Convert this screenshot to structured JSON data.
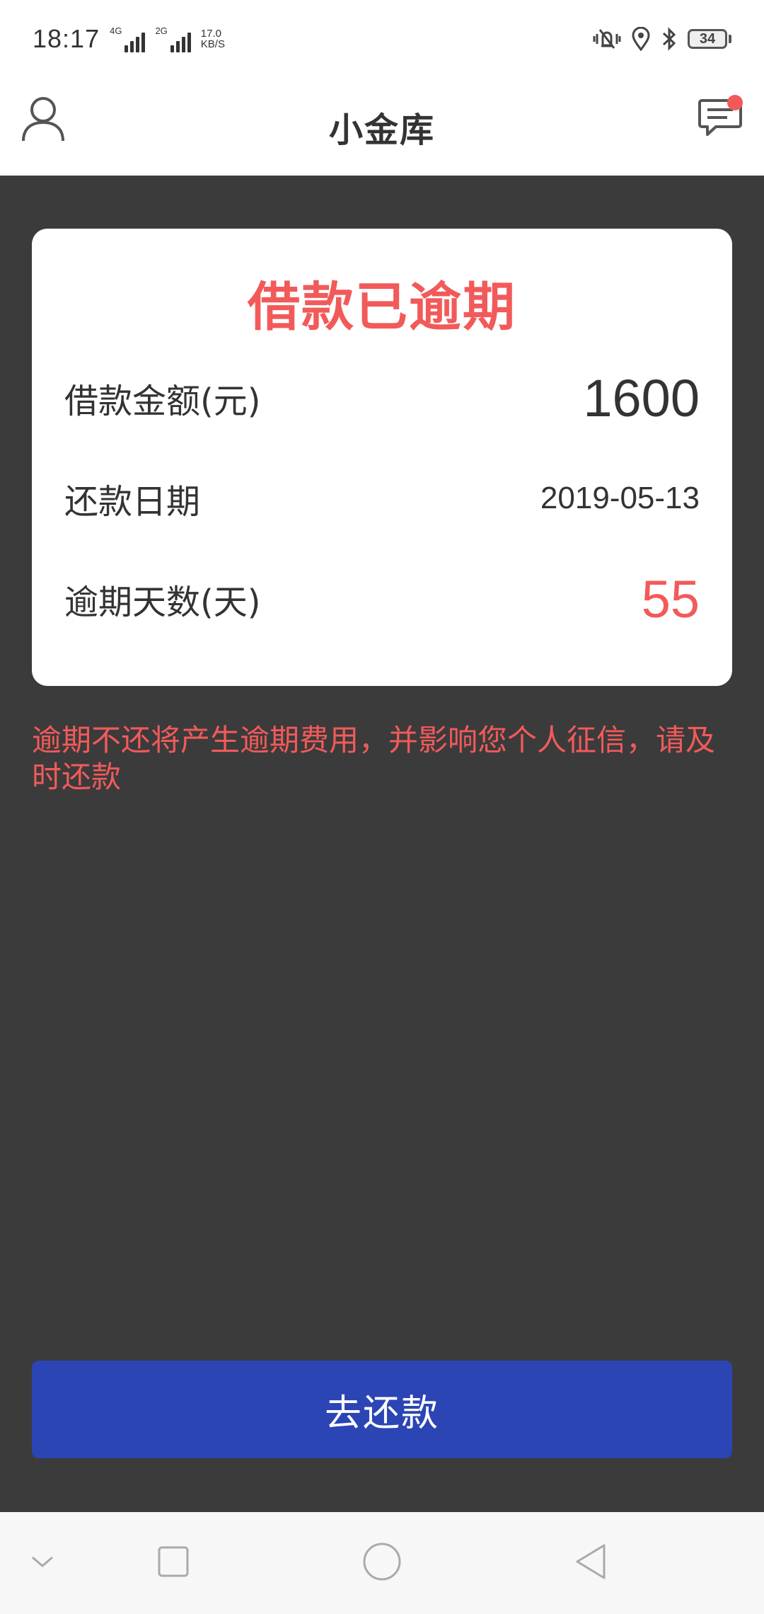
{
  "status_bar": {
    "time": "18:17",
    "network_1": "4G",
    "network_2": "2G",
    "speed_value": "17.0",
    "speed_unit": "KB/S",
    "battery": "34"
  },
  "header": {
    "title": "小金库"
  },
  "card": {
    "title": "借款已逾期",
    "rows": [
      {
        "label": "借款金额(元)",
        "value": "1600"
      },
      {
        "label": "还款日期",
        "value": "2019-05-13"
      },
      {
        "label": "逾期天数(天)",
        "value": "55"
      }
    ]
  },
  "warning": "逾期不还将产生逾期费用，并影响您个人征信，请及时还款",
  "actions": {
    "repay_label": "去还款"
  },
  "colors": {
    "accent_red": "#f25a5a",
    "button_blue": "#2b45b5",
    "background": "#3b3b3b"
  },
  "icons": {
    "profile": "user-icon",
    "messages": "chat-icon",
    "nav_down": "chevron-down-icon",
    "nav_recent": "square-icon",
    "nav_home": "circle-icon",
    "nav_back": "triangle-back-icon"
  }
}
